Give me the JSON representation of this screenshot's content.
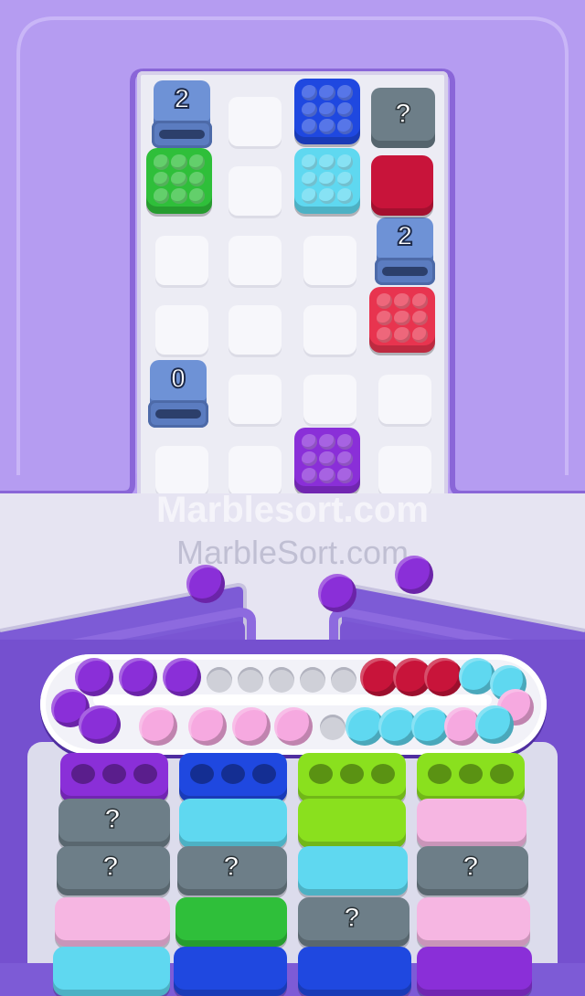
{
  "board": {
    "pipes": [
      {
        "count": "2"
      },
      {
        "count": "2"
      },
      {
        "count": "0"
      }
    ],
    "mystery_label": "?",
    "blocks": [
      {
        "color": "#2fbf3a",
        "name": "green"
      },
      {
        "color": "#1f48e0",
        "name": "blue"
      },
      {
        "color": "#5fd8f0",
        "name": "cyan"
      },
      {
        "color": "#c8143a",
        "name": "dark-red"
      },
      {
        "color": "#e8344f",
        "name": "red"
      },
      {
        "color": "#8a2fd8",
        "name": "purple"
      }
    ]
  },
  "watermark": {
    "primary": "Marblesort.com",
    "secondary": "MarbleSort.com"
  },
  "containers": [
    {
      "top_color": "#8a2fd8",
      "layers": [
        "mystery",
        "#5fd8f0"
      ]
    },
    {
      "top_color": "#1f48e0",
      "layers": [
        "#5fd8f0",
        "mystery"
      ]
    },
    {
      "top_color": "#7be020",
      "layers": [
        "#8ae01e",
        "#5fd8f0"
      ]
    },
    {
      "top_color": "#8ae01e",
      "layers": [
        "#f8b2e0",
        "mystery"
      ]
    }
  ],
  "colors": {
    "purple": "#8a2fd8",
    "pink": "#f6a9e0",
    "cyan": "#5fd8f0",
    "dark_red": "#c8143a"
  }
}
